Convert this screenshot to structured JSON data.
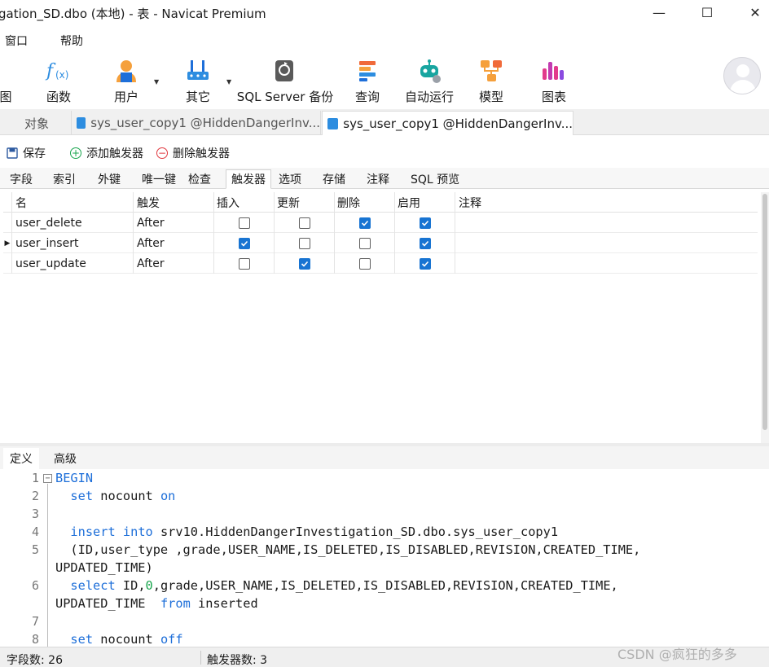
{
  "window": {
    "title": "gation_SD.dbo (本地) - 表 - Navicat Premium",
    "minimize": "—",
    "maximize": "☐",
    "close": "✕"
  },
  "menu": {
    "items": [
      "窗口",
      "帮助"
    ]
  },
  "toolbar": {
    "items": [
      {
        "label": "图",
        "icon": "database-icon"
      },
      {
        "label": "函数",
        "icon": "function-icon"
      },
      {
        "label": "用户",
        "icon": "user-icon"
      },
      {
        "label": "其它",
        "icon": "tools-icon"
      },
      {
        "label": "SQL Server 备份",
        "icon": "backup-icon"
      },
      {
        "label": "查询",
        "icon": "query-icon"
      },
      {
        "label": "自动运行",
        "icon": "robot-icon"
      },
      {
        "label": "模型",
        "icon": "model-icon"
      },
      {
        "label": "图表",
        "icon": "chart-icon"
      }
    ]
  },
  "tabs": {
    "objects": "对象",
    "tab1": "sys_user_copy1 @HiddenDangerInv...",
    "tab2": "sys_user_copy1 @HiddenDangerInv..."
  },
  "actions": {
    "save": "保存",
    "add_trigger": "添加触发器",
    "delete_trigger": "删除触发器"
  },
  "subtabs": [
    "字段",
    "索引",
    "外键",
    "唯一键",
    "检查",
    "触发器",
    "选项",
    "存储",
    "注释",
    "SQL 预览"
  ],
  "grid": {
    "headers": [
      "名",
      "触发",
      "插入",
      "更新",
      "删除",
      "启用",
      "注释"
    ],
    "rows": [
      {
        "name": "user_delete",
        "fire": "After",
        "insert": false,
        "update": false,
        "delete": true,
        "enabled": true,
        "note": ""
      },
      {
        "name": "user_insert",
        "fire": "After",
        "insert": true,
        "update": false,
        "delete": false,
        "enabled": true,
        "note": ""
      },
      {
        "name": "user_update",
        "fire": "After",
        "insert": false,
        "update": true,
        "delete": false,
        "enabled": true,
        "note": ""
      }
    ],
    "current_row": 1,
    "row_marker": "▶"
  },
  "deftabs": [
    "定义",
    "高级"
  ],
  "editor": {
    "line_numbers": [
      "1",
      "2",
      "3",
      "4",
      "5",
      "",
      "6",
      "",
      "7",
      "8"
    ],
    "fold_marker": "−"
  },
  "status": {
    "field_count": "字段数: 26",
    "trigger_count": "触发器数: 3"
  },
  "watermark": "CSDN @疯狂的多多",
  "colors": {
    "accent": "#1874d2",
    "keyword": "#1e6fd9",
    "number": "#18a54d"
  }
}
